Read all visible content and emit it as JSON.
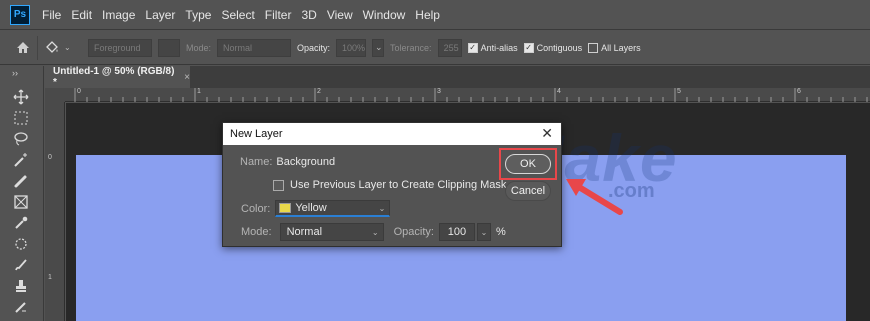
{
  "app": {
    "logo_text": "Ps"
  },
  "menu": {
    "items": [
      "File",
      "Edit",
      "Image",
      "Layer",
      "Type",
      "Select",
      "Filter",
      "3D",
      "View",
      "Window",
      "Help"
    ]
  },
  "options_bar": {
    "fill_source": "Foreground",
    "mode_label": "Mode:",
    "mode_value": "Normal",
    "opacity_label": "Opacity:",
    "opacity_value": "100%",
    "tolerance_label": "Tolerance:",
    "tolerance_value": "255",
    "anti_alias": "Anti-alias",
    "contiguous": "Contiguous",
    "all_layers": "All Layers"
  },
  "document": {
    "tab_title": "Untitled-1 @ 50% (RGB/8) *",
    "close_glyph": "×",
    "ruler_numbers": [
      "0",
      "1",
      "2",
      "3",
      "4",
      "5",
      "6"
    ],
    "v_ruler_numbers": [
      "0",
      "1"
    ]
  },
  "watermark": {
    "text": "TipsMake",
    "suffix": ".com"
  },
  "dialog": {
    "title": "New Layer",
    "close_glyph": "✕",
    "name_label": "Name:",
    "name_value": "Background",
    "clipping_label": "Use Previous Layer to Create Clipping Mask",
    "color_label": "Color:",
    "color_value": "Yellow",
    "mode_label": "Mode:",
    "mode_value": "Normal",
    "opacity_label": "Opacity:",
    "opacity_value": "100",
    "opacity_unit": "%",
    "ok_label": "OK",
    "cancel_label": "Cancel"
  },
  "colors": {
    "canvas": "#8a9ff0",
    "ui_background": "#535353",
    "highlight": "#e8474a",
    "swatch_yellow": "#e8d84a"
  },
  "icons": [
    "move-icon",
    "marquee-icon",
    "lasso-icon",
    "magic-wand-icon",
    "healing-brush-icon",
    "crop-icon",
    "eyedropper-icon",
    "patch-icon",
    "brush-icon",
    "stamp-icon",
    "history-brush-icon"
  ]
}
